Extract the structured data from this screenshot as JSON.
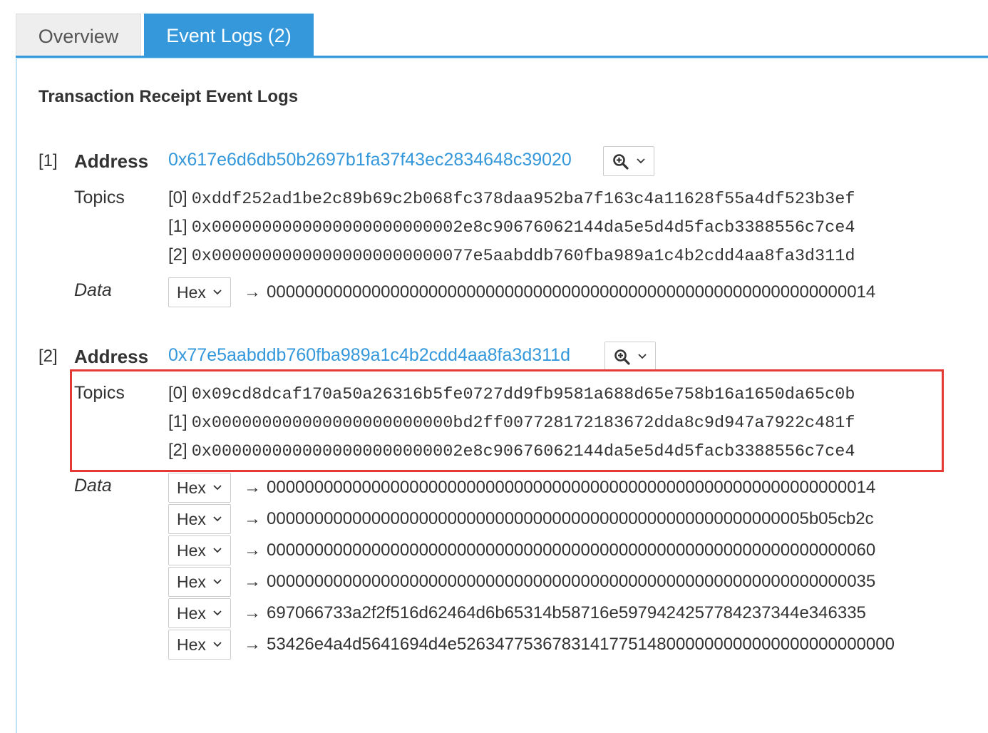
{
  "tabs": {
    "overview": "Overview",
    "event_logs": "Event Logs (2)"
  },
  "heading": "Transaction Receipt Event Logs",
  "labels": {
    "address": "Address",
    "topics": "Topics",
    "data": "Data",
    "hex": "Hex",
    "arrow": "→"
  },
  "logs": [
    {
      "index": "[1]",
      "address": "0x617e6d6db50b2697b1fa37f43ec2834648c39020",
      "topics": [
        {
          "idx": "[0]",
          "hash": "0xddf252ad1be2c89b69c2b068fc378daa952ba7f163c4a11628f55a4df523b3ef"
        },
        {
          "idx": "[1]",
          "hash": "0x0000000000000000000000002e8c90676062144da5e5d4d5facb3388556c7ce4"
        },
        {
          "idx": "[2]",
          "hash": "0x00000000000000000000000077e5aabddb760fba989a1c4b2cdd4aa8fa3d311d"
        }
      ],
      "data": [
        "0000000000000000000000000000000000000000000000000000000000000014"
      ]
    },
    {
      "index": "[2]",
      "address": "0x77e5aabddb760fba989a1c4b2cdd4aa8fa3d311d",
      "topics": [
        {
          "idx": "[0]",
          "hash": "0x09cd8dcaf170a50a26316b5fe0727dd9fb9581a688d65e758b16a1650da65c0b"
        },
        {
          "idx": "[1]",
          "hash": "0x000000000000000000000000bd2ff007728172183672dda8c9d947a7922c481f"
        },
        {
          "idx": "[2]",
          "hash": "0x0000000000000000000000002e8c90676062144da5e5d4d5facb3388556c7ce4"
        }
      ],
      "data": [
        "0000000000000000000000000000000000000000000000000000000000000014",
        "000000000000000000000000000000000000000000000000000000005b05cb2c",
        "0000000000000000000000000000000000000000000000000000000000000060",
        "0000000000000000000000000000000000000000000000000000000000000035",
        "697066733a2f2f516d62464d6b65314b58716e5979424257784237344e346335",
        "53426e4a4d5641694d4e5263477536783141775148000000000000000000000000"
      ]
    }
  ],
  "colors": {
    "accent": "#3498db",
    "highlight": "#e53935"
  }
}
